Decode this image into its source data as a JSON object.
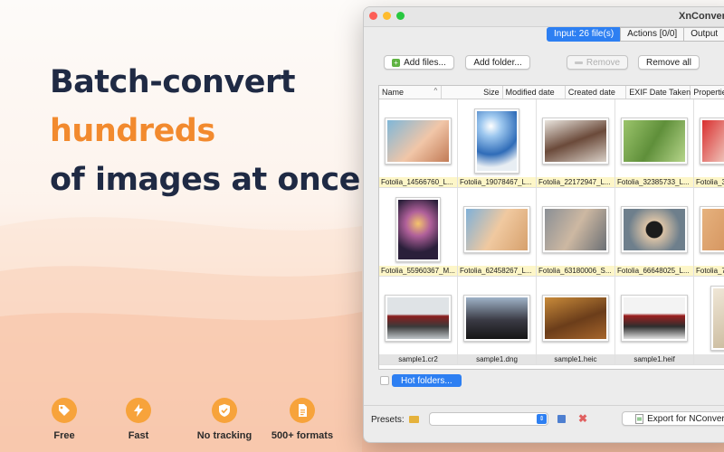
{
  "headline": {
    "line1": "Batch-convert",
    "line2": "hundreds",
    "line3": "of images at once"
  },
  "features": [
    {
      "label": "Free",
      "icon": "tag-icon"
    },
    {
      "label": "Fast",
      "icon": "lightning-icon"
    },
    {
      "label": "No tracking",
      "icon": "shield-check-icon"
    },
    {
      "label": "500+ formats",
      "icon": "document-icon"
    }
  ],
  "window": {
    "title": "XnConvert",
    "tabs": [
      "Input: 26 file(s)",
      "Actions [0/0]",
      "Output"
    ],
    "toolbar": {
      "add_files": "Add files...",
      "add_folder": "Add folder...",
      "remove": "Remove",
      "remove_all": "Remove all"
    },
    "columns": [
      "Name",
      "Size",
      "Modified date",
      "Created date",
      "EXIF Date Taken",
      "Properties"
    ],
    "files": [
      [
        "Fotolia_14566760_L...",
        "Fotolia_19078467_L...",
        "Fotolia_22172947_L...",
        "Fotolia_32385733_L...",
        "Fotolia_3..."
      ],
      [
        "Fotolia_55960367_M...",
        "Fotolia_62458267_L...",
        "Fotolia_63180006_S...",
        "Fotolia_66648025_L...",
        "Fotolia_7..."
      ],
      [
        "sample1.cr2",
        "sample1.dng",
        "sample1.heic",
        "sample1.heif",
        ""
      ]
    ],
    "hot_folders": "Hot folders...",
    "presets_label": "Presets:",
    "export_label": "Export for NConvert..."
  },
  "colors": {
    "navy": "#1f2a44",
    "accent_orange": "#f28a2e",
    "icon_orange": "#f7a33b",
    "selection_blue": "#2d7ff2"
  }
}
